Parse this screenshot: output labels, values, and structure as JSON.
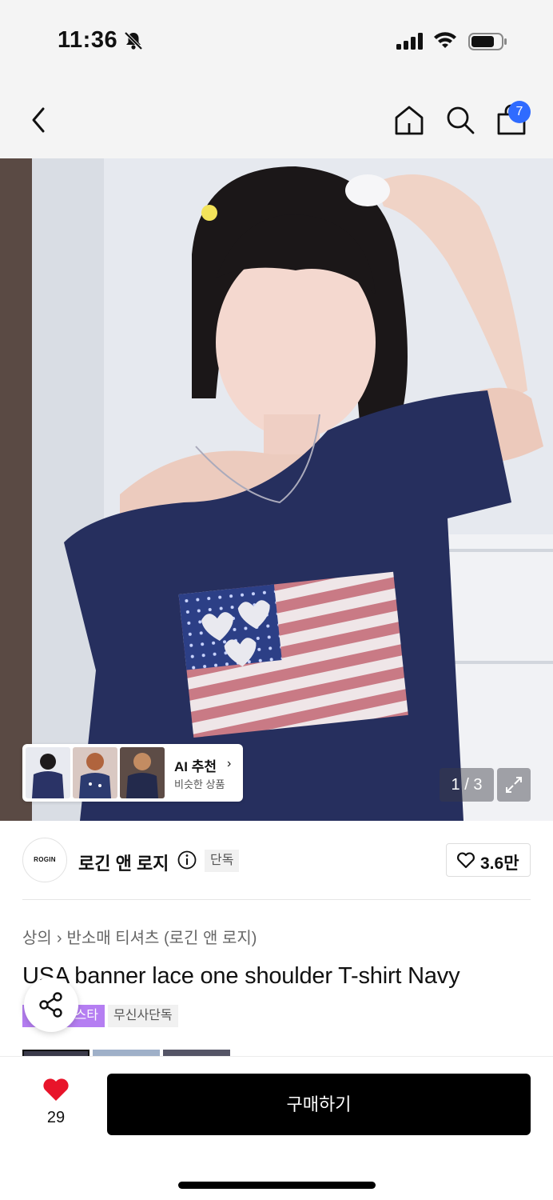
{
  "status": {
    "time": "11:36"
  },
  "header": {
    "cart_count": "7"
  },
  "hero": {
    "counter": "1 / 3"
  },
  "ai_reco": {
    "title": "AI 추천",
    "subtitle": "비슷한 상품"
  },
  "brand": {
    "logo_text": "ROGIN",
    "name": "로긴 앤 로지",
    "tag": "단독",
    "likes": "3.6만"
  },
  "breadcrumb": {
    "category": "상의",
    "subcategory": "반소매 티셔츠 (로긴 앤 로지)"
  },
  "product": {
    "title": "USA banner lace one shoulder T-shirt Navy"
  },
  "badges": {
    "purple": "스타",
    "gray": "무신사단독"
  },
  "bottom": {
    "wish_count": "29",
    "buy_label": "구매하기"
  },
  "colors": {
    "accent_blue": "#2f6bff",
    "heart_red": "#e8142a",
    "badge_purple": "#b57ef2",
    "navy": "#262f5e"
  },
  "icons": [
    "bell-slash-icon",
    "signal-icon",
    "wifi-icon",
    "battery-icon",
    "back-arrow-icon",
    "home-icon",
    "search-icon",
    "shopping-bag-icon",
    "expand-icon",
    "info-icon",
    "heart-outline-icon",
    "share-icon",
    "heart-filled-icon"
  ]
}
